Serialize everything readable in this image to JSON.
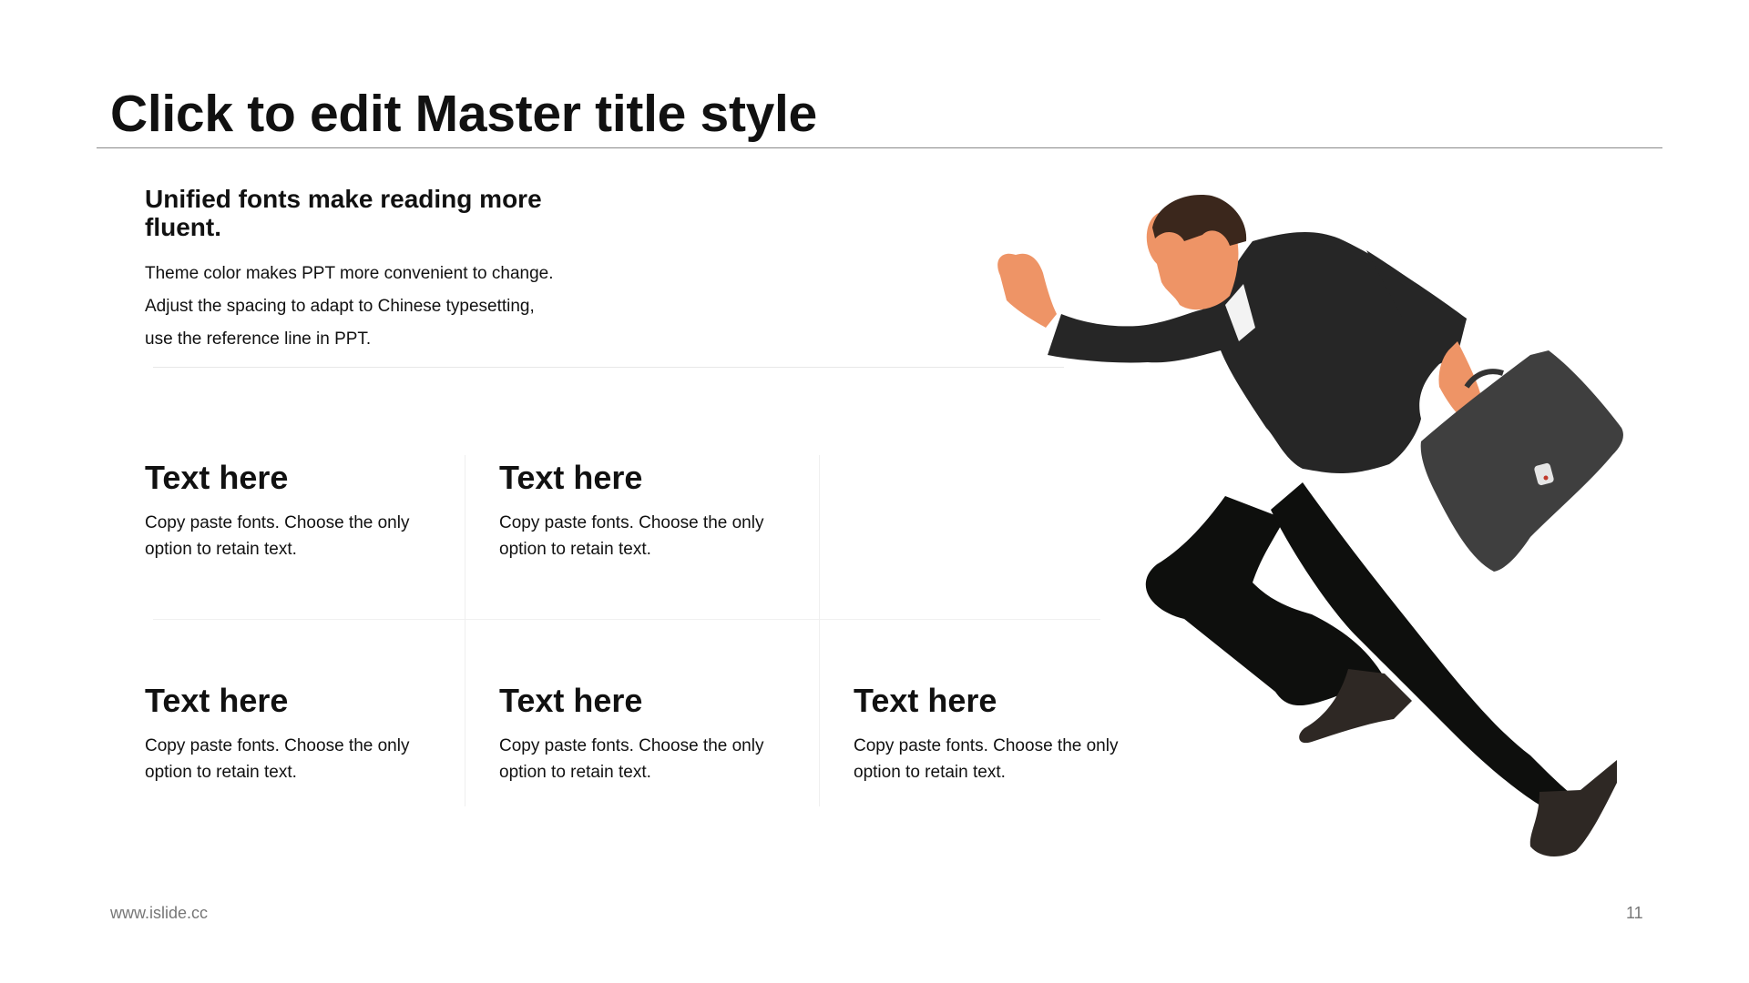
{
  "slide": {
    "title": "Click to edit Master title style",
    "intro_heading": "Unified fonts make reading more fluent.",
    "intro_lines": [
      "Theme color makes PPT more convenient to change.",
      "Adjust the spacing to adapt to Chinese typesetting,",
      "use the reference line in PPT."
    ]
  },
  "grid": {
    "row1": [
      {
        "title": "Text here",
        "body": "Copy paste fonts. Choose the only option to retain text."
      },
      {
        "title": "Text here",
        "body": "Copy paste fonts. Choose the only option to retain text."
      }
    ],
    "row2": [
      {
        "title": "Text here",
        "body": "Copy paste fonts. Choose the only option to retain text."
      },
      {
        "title": "Text here",
        "body": "Copy paste fonts. Choose the only option to retain text."
      },
      {
        "title": "Text here",
        "body": "Copy paste fonts. Choose the only option to retain text."
      }
    ]
  },
  "footer": {
    "url": "www.islide.cc",
    "page_number": "11"
  },
  "illustration": {
    "icon": "running-businessman-with-briefcase-illustration",
    "colors": {
      "suit": "#262626",
      "pants": "#0e0f0d",
      "skin": "#ee9466",
      "hair": "#3b271c",
      "briefcase": "#3f3f3f",
      "shoes": "#2e2824"
    }
  }
}
